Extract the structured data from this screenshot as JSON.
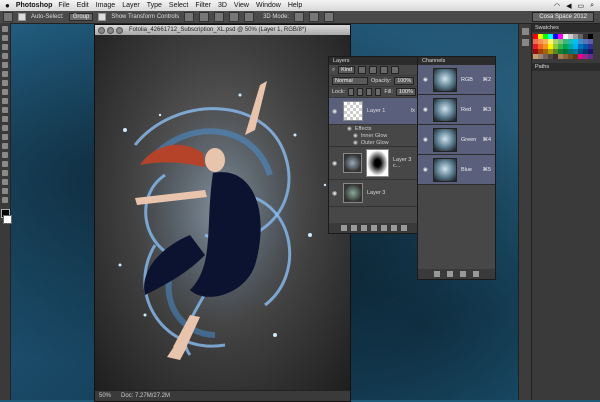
{
  "menubar": {
    "app_name": "Photoshop",
    "items": [
      "File",
      "Edit",
      "Image",
      "Layer",
      "Type",
      "Select",
      "Filter",
      "3D",
      "View",
      "Window",
      "Help"
    ],
    "status_icons": [
      "wifi-icon",
      "volume-icon",
      "battery-icon",
      "search-icon"
    ]
  },
  "options_bar": {
    "auto_select_label": "Auto-Select:",
    "auto_select_value": "Group",
    "show_transform_label": "Show Transform Controls",
    "mode_label": "3D Mode:",
    "workspace": "Cosa Space 2012"
  },
  "document": {
    "title": "Fotolia_42661712_Subscription_XL.psd @ 50% (Layer 1, RGB/8*)",
    "zoom": "50%",
    "doc_size": "Doc: 7.27M/27.2M"
  },
  "layers_panel": {
    "tabs": [
      "Layers"
    ],
    "filter_label": "Kind",
    "blend_mode": "Normal",
    "opacity_label": "Opacity:",
    "opacity_value": "100%",
    "lock_label": "Lock:",
    "fill_label": "Fill:",
    "fill_value": "100%",
    "layers": [
      {
        "name": "Layer 1",
        "fx": "fx"
      },
      {
        "name": "Layer 3 c..."
      },
      {
        "name": "Layer 3"
      }
    ],
    "effects_label": "Effects",
    "effects": [
      "Inner Glow",
      "Outer Glow"
    ],
    "bottom_icons": [
      "link-icon",
      "fx-icon",
      "mask-icon",
      "adjustment-icon",
      "folder-icon",
      "new-layer-icon",
      "trash-icon"
    ]
  },
  "channels_panel": {
    "tabs": [
      "Channels"
    ],
    "channels": [
      {
        "name": "RGB",
        "shortcut": "⌘2"
      },
      {
        "name": "Red",
        "shortcut": "⌘3"
      },
      {
        "name": "Green",
        "shortcut": "⌘4"
      },
      {
        "name": "Blue",
        "shortcut": "⌘5"
      }
    ]
  },
  "right_dock": {
    "swatches_tab": "Swatches",
    "paths_tab": "Paths",
    "swatch_colors": [
      "#ff0000",
      "#ffff00",
      "#00ff00",
      "#00ffff",
      "#0000ff",
      "#ff00ff",
      "#ffffff",
      "#cccccc",
      "#999999",
      "#666666",
      "#333333",
      "#000000",
      "#f26c4f",
      "#f68e55",
      "#fbaf5c",
      "#fff467",
      "#acd372",
      "#7cc576",
      "#3bb878",
      "#1abbb4",
      "#00bff3",
      "#438cca",
      "#5574b9",
      "#605ca8",
      "#ed1c24",
      "#f26522",
      "#f7941d",
      "#fff200",
      "#8dc73f",
      "#39b54a",
      "#00a651",
      "#00a99d",
      "#00aeef",
      "#0072bc",
      "#0054a6",
      "#2e3192",
      "#9e0b0f",
      "#a0410d",
      "#a36209",
      "#aba000",
      "#598527",
      "#1a7b30",
      "#007236",
      "#00746b",
      "#0076a3",
      "#004b80",
      "#003471",
      "#1b1464",
      "#c69c6d",
      "#998675",
      "#736357",
      "#534741",
      "#362f2d",
      "#a67c52",
      "#8c6239",
      "#754c24",
      "#603913",
      "#ec008c",
      "#92278f",
      "#662d91"
    ],
    "accent": "#5a607c"
  }
}
